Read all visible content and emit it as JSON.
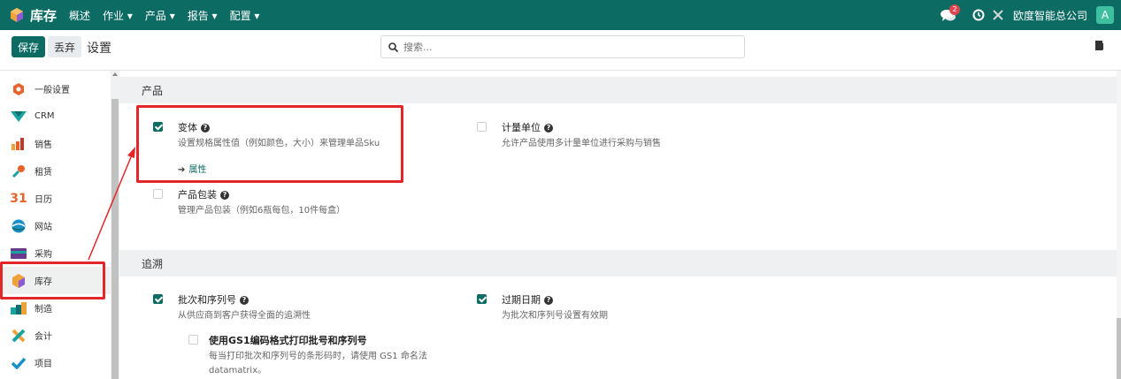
{
  "navbar": {
    "app_name": "库存",
    "menu": [
      "概述",
      "作业 ▾",
      "产品 ▾",
      "报告 ▾",
      "配置 ▾"
    ],
    "chat_badge": "2",
    "company": "欧度智能总公司",
    "avatar_letter": "A"
  },
  "control": {
    "save_label": "保存",
    "discard_label": "丢弃",
    "breadcrumb": "设置",
    "search_placeholder": "搜索..."
  },
  "sidebar": {
    "items": [
      {
        "label": "一般设置",
        "icon": "general-settings-icon"
      },
      {
        "label": "CRM",
        "icon": "crm-icon"
      },
      {
        "label": "销售",
        "icon": "sales-icon"
      },
      {
        "label": "租赁",
        "icon": "rental-icon"
      },
      {
        "label": "日历",
        "icon": "calendar-icon",
        "icon_text": "31"
      },
      {
        "label": "网站",
        "icon": "website-icon"
      },
      {
        "label": "采购",
        "icon": "purchase-icon"
      },
      {
        "label": "库存",
        "icon": "inventory-icon",
        "active": true
      },
      {
        "label": "制造",
        "icon": "manufacturing-icon"
      },
      {
        "label": "会计",
        "icon": "accounting-icon"
      },
      {
        "label": "项目",
        "icon": "project-icon"
      }
    ]
  },
  "sections": {
    "products": {
      "title": "产品",
      "variants": {
        "title": "变体",
        "desc": "设置规格属性值（例如颜色，大小）来管理单品Sku",
        "link": "属性",
        "checked": true
      },
      "uom": {
        "title": "计量单位",
        "desc": "允许产品使用多计量单位进行采购与销售",
        "checked": false
      },
      "packaging": {
        "title": "产品包装",
        "desc": "管理产品包装（例如6瓶每包，10件每盒）",
        "checked": false
      }
    },
    "traceability": {
      "title": "追溯",
      "lots": {
        "title": "批次和序列号",
        "desc": "从供应商到客户获得全面的追溯性",
        "checked": true
      },
      "expiry": {
        "title": "过期日期",
        "desc": "为批次和序列号设置有效期",
        "checked": true
      },
      "gs1": {
        "title": "使用GS1编码格式打印批号和序列号",
        "desc_line1": "每当打印批次和序列号的条形码时，请使用 GS1 命名法",
        "desc_line2": "datamatrix。",
        "checked": false
      }
    }
  },
  "colors": {
    "brand": "#0c6b63",
    "highlight": "#e3262a"
  }
}
